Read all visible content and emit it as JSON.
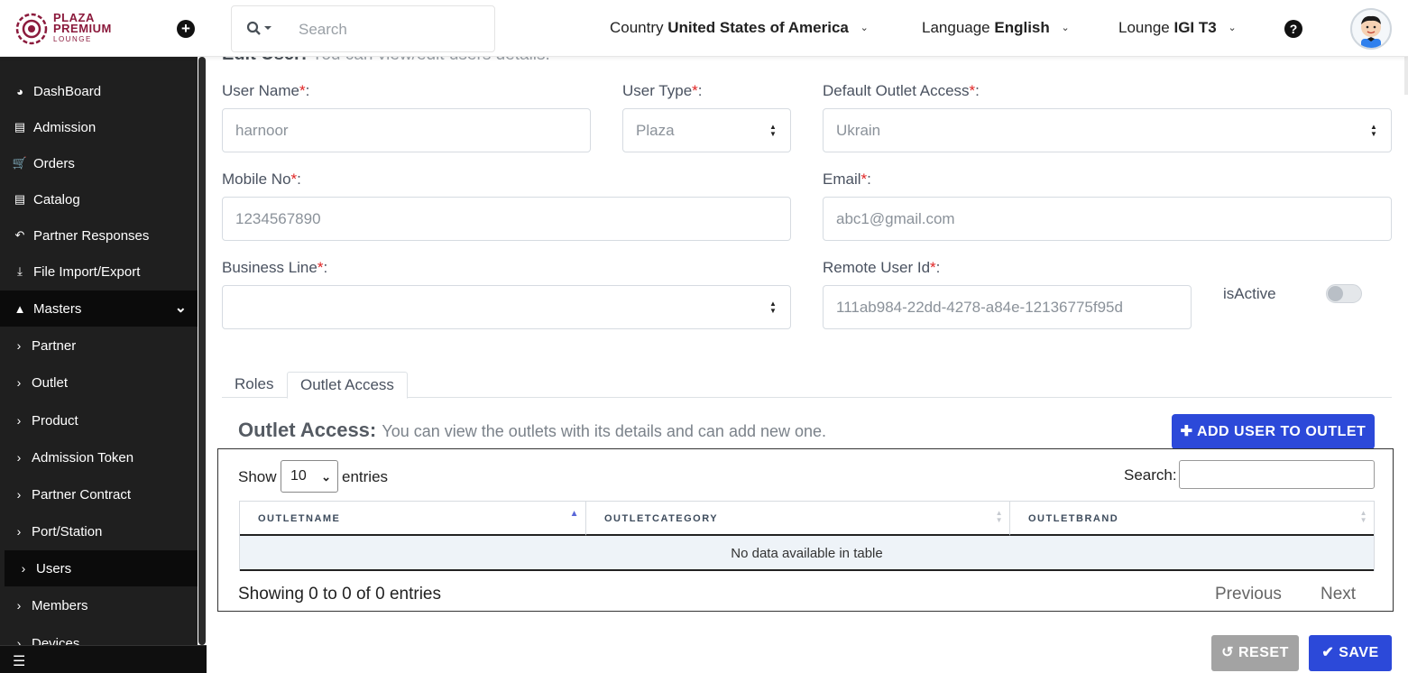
{
  "header": {
    "logo": {
      "line1": "PLAZA",
      "line2": "PREMIUM",
      "line3": "LOUNGE"
    },
    "search_placeholder": "Search",
    "country_label": "Country",
    "country_value": "United States of America",
    "language_label": "Language",
    "language_value": "English",
    "lounge_label": "Lounge",
    "lounge_value": "IGI T3"
  },
  "sidebar": {
    "items": [
      {
        "label": "DashBoard",
        "icon": "dashboard-icon"
      },
      {
        "label": "Admission",
        "icon": "id-card-icon"
      },
      {
        "label": "Orders",
        "icon": "cart-icon"
      },
      {
        "label": "Catalog",
        "icon": "document-icon"
      },
      {
        "label": "Partner Responses",
        "icon": "reply-all-icon"
      },
      {
        "label": "File Import/Export",
        "icon": "download-icon"
      },
      {
        "label": "Masters",
        "icon": "sitemap-icon"
      }
    ],
    "sub_items": [
      {
        "label": "Partner"
      },
      {
        "label": "Outlet"
      },
      {
        "label": "Product"
      },
      {
        "label": "Admission Token"
      },
      {
        "label": "Partner Contract"
      },
      {
        "label": "Port/Station"
      },
      {
        "label": "Users"
      },
      {
        "label": "Members"
      },
      {
        "label": "Devices"
      }
    ]
  },
  "form": {
    "title": "Edit User:",
    "subtitle": "You can view/edit users details.",
    "user_name_label": "User Name",
    "user_name_value": "harnoor",
    "user_type_label": "User Type",
    "user_type_value": "Plaza",
    "default_outlet_label": "Default Outlet Access",
    "default_outlet_value": "Ukrain",
    "mobile_label": "Mobile No",
    "mobile_value": "1234567890",
    "email_label": "Email",
    "email_value": "abc1@gmail.com",
    "business_line_label": "Business Line",
    "business_line_value": "",
    "remote_user_label": "Remote User Id",
    "remote_user_value": "111ab984-22dd-4278-a84e-12136775f95d",
    "is_active_label": "isActive",
    "is_active": false,
    "required_mark": "*",
    "colon": ":"
  },
  "tabs": [
    {
      "label": "Roles",
      "active": false
    },
    {
      "label": "Outlet Access",
      "active": true
    }
  ],
  "outlet_access": {
    "title": "Outlet Access:",
    "description": "You can view the outlets with its details and can add new one.",
    "add_button": "ADD USER TO OUTLET",
    "show_label": "Show",
    "page_size": "10",
    "entries_label": "entries",
    "search_label": "Search:",
    "columns": [
      "OUTLETNAME",
      "OUTLETCATEGORY",
      "OUTLETBRAND"
    ],
    "empty_message": "No data available in table",
    "info": "Showing 0 to 0 of 0 entries",
    "prev": "Previous",
    "next": "Next"
  },
  "actions": {
    "reset": "RESET",
    "save": "SAVE"
  },
  "colors": {
    "primary": "#2c49d9",
    "sidebar_bg": "#1f1f1f",
    "sidebar_active": "#0b0b0b",
    "brand": "#8b1a3c",
    "required": "#e02424"
  }
}
